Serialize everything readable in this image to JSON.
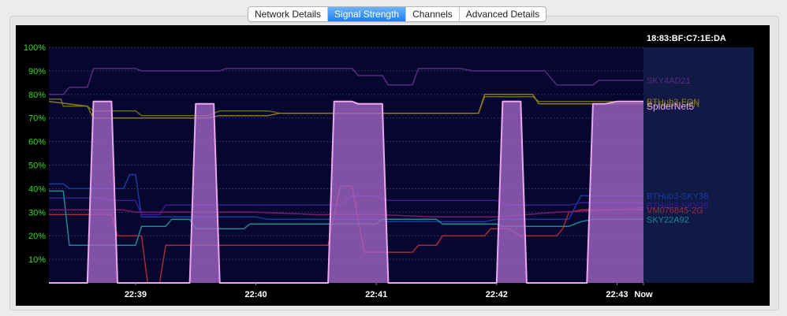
{
  "tabs": [
    {
      "label": "Network Details",
      "active": false
    },
    {
      "label": "Signal Strength",
      "active": true
    },
    {
      "label": "Channels",
      "active": false
    },
    {
      "label": "Advanced Details",
      "active": false
    }
  ],
  "colors": {
    "plot_background": "#06062e",
    "label_background": "#101a45",
    "tab_active": "#1a7ff5",
    "y_tick_label": "#33dd22",
    "x_tick_label": "#ffffff",
    "grid": "#2b3460",
    "highlight_fill": "#a467c8",
    "highlight_stroke": "#eaa6ee"
  },
  "chart_data": {
    "type": "line",
    "header_text": "18:83:BF:C7:1E:DA",
    "ylim": [
      0,
      100
    ],
    "yticks": [
      {
        "value": 10,
        "label": "10%"
      },
      {
        "value": 20,
        "label": "20%"
      },
      {
        "value": 30,
        "label": "30%"
      },
      {
        "value": 40,
        "label": "40%"
      },
      {
        "value": 50,
        "label": "50%"
      },
      {
        "value": 60,
        "label": "60%"
      },
      {
        "value": 70,
        "label": "70%"
      },
      {
        "value": 80,
        "label": "80%"
      },
      {
        "value": 90,
        "label": "90%"
      },
      {
        "value": 100,
        "label": "100%"
      }
    ],
    "xlim": [
      -0.22,
      4.72
    ],
    "xticks": [
      {
        "value": 0.5,
        "label": "22:39"
      },
      {
        "value": 1.5,
        "label": "22:40"
      },
      {
        "value": 2.5,
        "label": "22:41"
      },
      {
        "value": 3.5,
        "label": "22:42"
      },
      {
        "value": 4.5,
        "label": "22:43"
      },
      {
        "value": 4.72,
        "label": "Now"
      }
    ],
    "series": [
      {
        "name": "SKY4AD21",
        "color": "#5a2a80",
        "label_y": 86,
        "highlight": false,
        "points": [
          [
            -0.22,
            80
          ],
          [
            -0.1,
            80
          ],
          [
            -0.05,
            83
          ],
          [
            0.1,
            83
          ],
          [
            0.15,
            91
          ],
          [
            0.5,
            91
          ],
          [
            0.55,
            90
          ],
          [
            1.2,
            90
          ],
          [
            1.25,
            91
          ],
          [
            2.3,
            91
          ],
          [
            2.35,
            88
          ],
          [
            2.55,
            88
          ],
          [
            2.6,
            84
          ],
          [
            2.8,
            84
          ],
          [
            2.85,
            91
          ],
          [
            3.2,
            91
          ],
          [
            3.3,
            90
          ],
          [
            3.9,
            90
          ],
          [
            4.0,
            84
          ],
          [
            4.3,
            84
          ],
          [
            4.35,
            86
          ],
          [
            4.72,
            86
          ]
        ]
      },
      {
        "name": "BTHub3-FON",
        "color": "#6a6a1e",
        "label_y": 76,
        "highlight": false,
        "points": [
          [
            -0.22,
            78
          ],
          [
            -0.12,
            78
          ],
          [
            -0.1,
            75
          ],
          [
            0.1,
            75
          ],
          [
            0.15,
            73
          ],
          [
            0.5,
            73
          ],
          [
            0.55,
            71
          ],
          [
            1.1,
            71
          ],
          [
            1.2,
            73
          ],
          [
            1.6,
            73
          ],
          [
            1.7,
            72
          ],
          [
            3.0,
            72
          ],
          [
            3.35,
            72
          ],
          [
            3.4,
            79
          ],
          [
            3.6,
            79
          ],
          [
            3.8,
            79
          ],
          [
            3.85,
            77
          ],
          [
            4.72,
            77
          ]
        ]
      },
      {
        "name": "BTHub3-FON",
        "color": "#8a7a20",
        "label_y": 77,
        "highlight": false,
        "points": [
          [
            -0.22,
            77
          ],
          [
            0.1,
            75
          ],
          [
            0.15,
            70
          ],
          [
            1.1,
            70
          ],
          [
            1.2,
            71
          ],
          [
            1.6,
            71
          ],
          [
            1.7,
            72
          ],
          [
            3.35,
            72
          ],
          [
            3.4,
            80
          ],
          [
            3.6,
            80
          ],
          [
            3.8,
            80
          ],
          [
            3.85,
            76
          ],
          [
            4.72,
            76
          ]
        ]
      },
      {
        "name": "SpiderNet5",
        "color": "#eaa6ee",
        "label_y": 75,
        "highlight": true,
        "points": [
          [
            -0.22,
            0
          ],
          [
            0.1,
            0
          ],
          [
            0.15,
            77
          ],
          [
            0.3,
            77
          ],
          [
            0.35,
            0
          ],
          [
            0.95,
            0
          ],
          [
            1.0,
            76
          ],
          [
            1.15,
            76
          ],
          [
            1.2,
            0
          ],
          [
            2.1,
            0
          ],
          [
            2.15,
            77
          ],
          [
            2.3,
            77
          ],
          [
            2.35,
            76
          ],
          [
            2.55,
            76
          ],
          [
            2.6,
            0
          ],
          [
            3.5,
            0
          ],
          [
            3.55,
            77
          ],
          [
            3.7,
            77
          ],
          [
            3.75,
            0
          ],
          [
            4.25,
            0
          ],
          [
            4.3,
            76
          ],
          [
            4.4,
            76
          ],
          [
            4.5,
            77
          ],
          [
            4.72,
            77
          ]
        ]
      },
      {
        "name": "BTHub3-SKY38",
        "color": "#1a3aa0",
        "label_y": 37,
        "highlight": false,
        "points": [
          [
            -0.22,
            42
          ],
          [
            -0.1,
            42
          ],
          [
            -0.05,
            40
          ],
          [
            0.4,
            40
          ],
          [
            0.45,
            46
          ],
          [
            0.5,
            46
          ],
          [
            0.55,
            28
          ],
          [
            1.5,
            28
          ],
          [
            1.6,
            27
          ],
          [
            2.5,
            27
          ],
          [
            2.6,
            26
          ],
          [
            3.4,
            26
          ],
          [
            3.5,
            27
          ],
          [
            4.1,
            27
          ],
          [
            4.2,
            37
          ],
          [
            4.72,
            37
          ]
        ]
      },
      {
        "name": "BTHub3-SKY38",
        "color": "#3a1a9a",
        "label_y": 33,
        "highlight": false,
        "points": [
          [
            -0.22,
            36
          ],
          [
            0.2,
            36
          ],
          [
            0.3,
            35
          ],
          [
            0.5,
            35
          ],
          [
            0.55,
            29
          ],
          [
            0.7,
            29
          ],
          [
            0.75,
            33
          ],
          [
            2.2,
            33
          ],
          [
            2.3,
            37
          ],
          [
            2.5,
            37
          ],
          [
            2.6,
            35
          ],
          [
            3.5,
            35
          ],
          [
            3.6,
            33
          ],
          [
            4.1,
            33
          ],
          [
            4.2,
            34
          ],
          [
            4.72,
            34
          ]
        ]
      },
      {
        "name": "VM076845-2G",
        "color": "#a52a3a",
        "label_y": 31,
        "highlight": false,
        "points": [
          [
            -0.22,
            29
          ],
          [
            0.3,
            29
          ],
          [
            0.35,
            20
          ],
          [
            0.55,
            20
          ],
          [
            0.6,
            0
          ],
          [
            0.7,
            0
          ],
          [
            0.75,
            16
          ],
          [
            1.2,
            16
          ],
          [
            1.3,
            16
          ],
          [
            2.1,
            16
          ],
          [
            2.2,
            41
          ],
          [
            2.3,
            41
          ],
          [
            2.4,
            13
          ],
          [
            2.8,
            13
          ],
          [
            2.85,
            16
          ],
          [
            3.0,
            16
          ],
          [
            3.05,
            20
          ],
          [
            3.4,
            20
          ],
          [
            3.45,
            23
          ],
          [
            3.6,
            23
          ],
          [
            3.7,
            20
          ],
          [
            4.0,
            20
          ],
          [
            4.05,
            23
          ],
          [
            4.1,
            30
          ],
          [
            4.2,
            31
          ],
          [
            4.72,
            31
          ]
        ]
      },
      {
        "name": "SKY22A92",
        "color": "#1a8a9a",
        "label_y": 27,
        "highlight": false,
        "points": [
          [
            -0.22,
            39
          ],
          [
            -0.1,
            39
          ],
          [
            -0.05,
            16
          ],
          [
            0.3,
            16
          ],
          [
            0.35,
            16
          ],
          [
            0.5,
            16
          ],
          [
            0.55,
            24
          ],
          [
            0.75,
            24
          ],
          [
            0.8,
            27
          ],
          [
            0.95,
            27
          ],
          [
            1.0,
            23
          ],
          [
            1.4,
            23
          ],
          [
            1.45,
            25
          ],
          [
            2.5,
            25
          ],
          [
            2.55,
            27
          ],
          [
            3.0,
            27
          ],
          [
            3.05,
            25
          ],
          [
            3.5,
            25
          ],
          [
            3.55,
            24
          ],
          [
            4.1,
            24
          ],
          [
            4.2,
            26
          ],
          [
            4.3,
            27
          ],
          [
            4.72,
            27
          ]
        ]
      },
      {
        "name": "",
        "color": "#7a1a6a",
        "label_y": null,
        "highlight": false,
        "points": [
          [
            -0.22,
            31
          ],
          [
            0.4,
            31
          ],
          [
            0.5,
            30
          ],
          [
            1.5,
            30
          ],
          [
            2.0,
            29
          ],
          [
            2.5,
            29
          ],
          [
            3.0,
            28
          ],
          [
            3.5,
            28
          ],
          [
            4.0,
            30
          ],
          [
            4.5,
            31
          ],
          [
            4.72,
            32
          ]
        ]
      }
    ]
  }
}
